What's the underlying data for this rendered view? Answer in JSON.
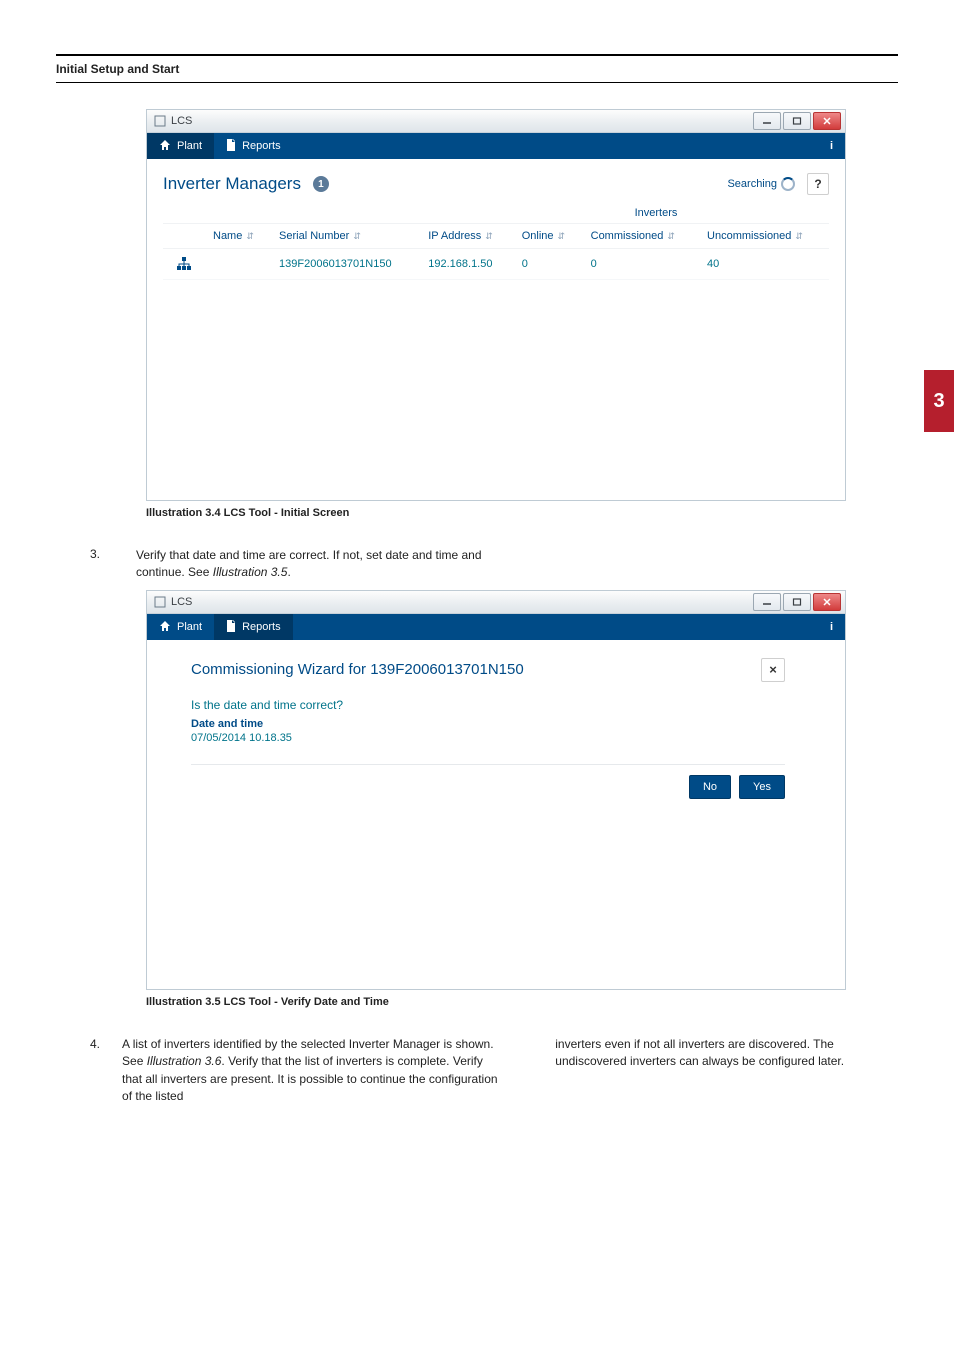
{
  "section_title": "Initial Setup and Start",
  "side_tab": "3",
  "figure1": {
    "window_title": "LCS",
    "tabs": {
      "plant": "Plant",
      "reports": "Reports"
    },
    "info_icon": "i",
    "heading": "Inverter Managers",
    "badge": "1",
    "searching": "Searching",
    "help": "?",
    "inverters_label": "Inverters",
    "columns": {
      "name": "Name",
      "serial": "Serial Number",
      "ip": "IP Address",
      "online": "Online",
      "commissioned": "Commissioned",
      "uncommissioned": "Uncommissioned"
    },
    "row": {
      "name": "",
      "serial": "139F2006013701N150",
      "ip": "192.168.1.50",
      "online": "0",
      "commissioned": "0",
      "uncommissioned": "40"
    },
    "caption": "Illustration 3.4 LCS Tool - Initial Screen"
  },
  "step3": {
    "num": "3.",
    "text_a": "Verify that date and time are correct. If not, set date and time and continue. See ",
    "text_ref": "Illustration 3.5",
    "text_b": "."
  },
  "figure2": {
    "window_title": "LCS",
    "tabs": {
      "plant": "Plant",
      "reports": "Reports"
    },
    "info_icon": "i",
    "wizard_title": "Commissioning Wizard for 139F2006013701N150",
    "close": "×",
    "question": "Is the date and time correct?",
    "dt_label": "Date and time",
    "dt_value": "07/05/2014 10.18.35",
    "btn_no": "No",
    "btn_yes": "Yes",
    "caption": "Illustration 3.5 LCS Tool - Verify Date and Time"
  },
  "step4": {
    "num": "4.",
    "left_a": "A list of inverters identified by the selected Inverter Manager is shown. See ",
    "left_ref": "Illustration 3.6",
    "left_b": ". Verify that the list of inverters is complete. Verify that all inverters are present. It is possible to continue the configuration of the listed",
    "right": "inverters even if not all inverters are discovered. The undiscovered inverters can always be configured later."
  }
}
